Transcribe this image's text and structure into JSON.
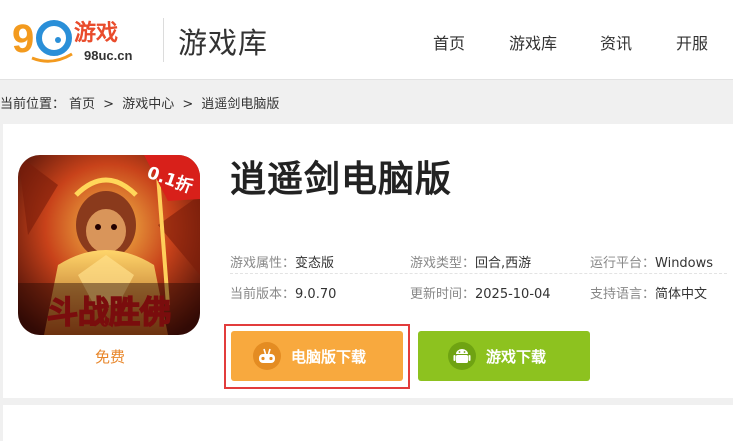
{
  "header": {
    "logo_brand": "游戏",
    "logo_domain": "98uc.cn",
    "section_title": "游戏库",
    "nav": [
      "首页",
      "游戏库",
      "资讯",
      "开服"
    ]
  },
  "breadcrumb": {
    "prefix": "当前位置：",
    "items": [
      "首页",
      "游戏中心",
      "逍遥剑电脑版"
    ],
    "separator": ">"
  },
  "game": {
    "title": "逍遥剑电脑版",
    "price": "免费",
    "icon_art_text": "斗战胜佛",
    "icon_badge": "0.1折",
    "attributes": [
      {
        "label": "游戏属性：",
        "value": "变态版"
      },
      {
        "label": "游戏类型：",
        "value": "回合,西游"
      },
      {
        "label": "运行平台：",
        "value": "Windows"
      },
      {
        "label": "当前版本：",
        "value": "9.0.70"
      },
      {
        "label": "更新时间：",
        "value": "2025-10-04"
      },
      {
        "label": "支持语言：",
        "value": "简体中文"
      }
    ]
  },
  "buttons": {
    "pc_download": "电脑版下载",
    "game_download": "游戏下载"
  },
  "colors": {
    "accent_orange": "#f8a93e",
    "accent_green": "#8dc21f",
    "highlight_red": "#e23c3c",
    "price_orange": "#e8862a"
  },
  "icons": [
    "joystick-icon",
    "android-icon"
  ]
}
